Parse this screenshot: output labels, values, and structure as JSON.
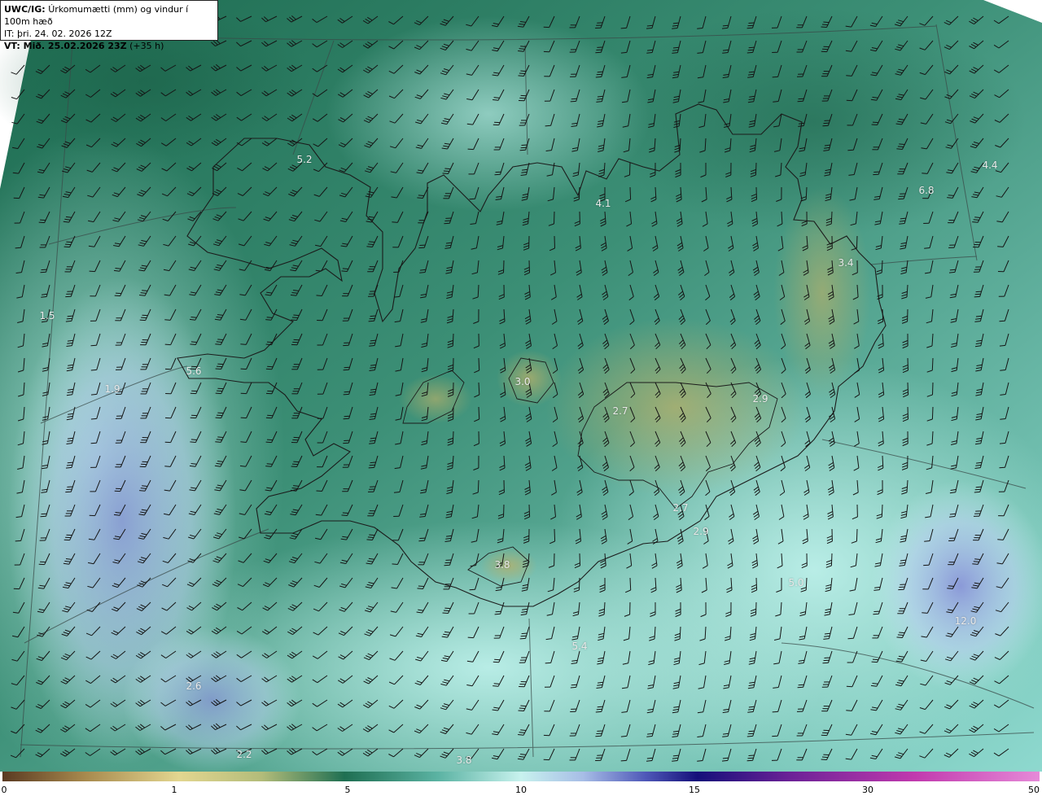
{
  "header": {
    "model": "UWC/IG:",
    "title": "Úrkomumætti (mm) og vindur í 100m hæð",
    "init_time": "IT: þri. 24. 02. 2026 12Z",
    "valid_prefix": "VT: Mið. 25.02.2026 23Z",
    "valid_offset": "(+35 h)"
  },
  "value_labels": [
    "5.2",
    "4.1",
    "4.4",
    "6.8",
    "3.4",
    "5.6",
    "3.0",
    "2.7",
    "2.9",
    "2.7",
    "2.9",
    "3.8",
    "5.0",
    "12.0",
    "5.4",
    "2.6",
    "2.2",
    "3.8",
    "1.5",
    "1.9"
  ],
  "colorbar": {
    "ticks": [
      "0",
      "1",
      "5",
      "10",
      "15",
      "30",
      "50"
    ],
    "colors": [
      "#5a3a22",
      "#8e6a3a",
      "#c9b065",
      "#e2d690",
      "#c6c686",
      "#8fae6a",
      "#3f8a62",
      "#1f6f52",
      "#3a9685",
      "#7fc9bf",
      "#bfeee8",
      "#d5eef4",
      "#a7bde6",
      "#6b79c9",
      "#2a2e9a",
      "#15107a",
      "#5c1b8f",
      "#a0309e",
      "#d34bb8",
      "#e37ad2"
    ]
  },
  "legend_colors": {
    "deep": "#1c6b4e",
    "mid": "#4a9f88",
    "light": "#a9e4dd",
    "olive": "#a3a65f",
    "blue": "#8e9dd8"
  }
}
